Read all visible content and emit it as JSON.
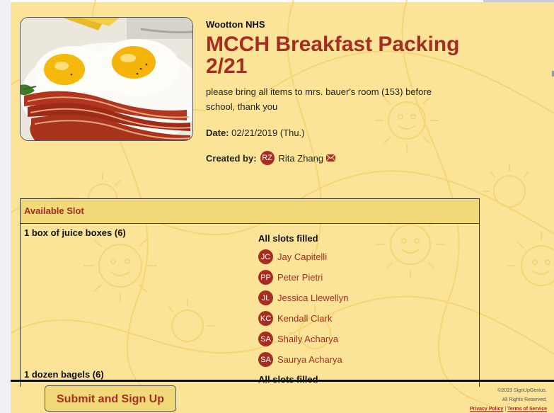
{
  "organization": "Wootton NHS",
  "title": "MCCH Breakfast Packing 2/21",
  "description": "please bring all items to mrs. bauer's room (153) before school, thank you",
  "date": {
    "label": "Date:",
    "value": "02/21/2019 (Thu.)"
  },
  "created_by": {
    "label": "Created by:",
    "initials": "RZ",
    "name": "Rita Zhang"
  },
  "hero_image": {
    "subject": "fried eggs and bacon breakfast plate"
  },
  "slots_table": {
    "header": "Available Slot",
    "rows": [
      {
        "name": "1 box of juice boxes (6)",
        "status": "All slots filled",
        "signups": [
          {
            "initials": "JC",
            "name": "Jay Capitelli"
          },
          {
            "initials": "PP",
            "name": "Peter Pietri"
          },
          {
            "initials": "JL",
            "name": "Jessica Llewellyn"
          },
          {
            "initials": "KC",
            "name": "Kendall Clark"
          },
          {
            "initials": "SA",
            "name": "Shaily Acharya"
          },
          {
            "initials": "SA",
            "name": "Saurya Acharya"
          }
        ]
      },
      {
        "name": "1 dozen bagels (6)",
        "status": "All slots filled"
      }
    ]
  },
  "submit_label": "Submit and Sign Up",
  "footer": {
    "copyright": "©2019 SignUpGenius.",
    "rights": "All Rights Reserved.",
    "privacy": "Privacy Policy",
    "separator": "|",
    "terms": "Terms of Service"
  },
  "colors": {
    "background": "#fbe497",
    "accent": "#a52d22",
    "header": "#f1d879"
  },
  "icons": {
    "mail": "envelope-icon"
  }
}
